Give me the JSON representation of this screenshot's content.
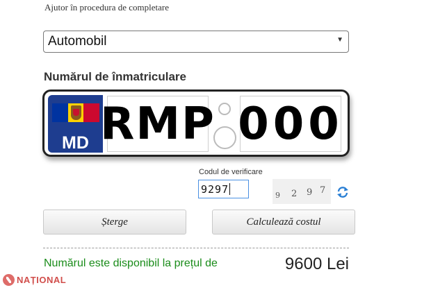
{
  "help_link": "Ajutor în procedura de completare",
  "vehicle_type": {
    "selected": "Automobil"
  },
  "plate": {
    "title": "Numărul de înmatriculare",
    "country_code": "MD",
    "series": "RMP",
    "number": "000"
  },
  "verification": {
    "label": "Codul de verificare",
    "input_value": "9297",
    "captcha_digits": [
      "9",
      "2",
      "9",
      "7"
    ]
  },
  "buttons": {
    "clear": "Șterge",
    "calculate": "Calculează costul"
  },
  "result": {
    "text": "Numărul este disponibil la prețul de",
    "price": "9600 Lei"
  },
  "watermark": {
    "text": "NAȚIONAL"
  },
  "colors": {
    "plate_blue": "#1e3d8f",
    "result_green": "#1a8c1a",
    "input_focus": "#4a90e2"
  }
}
